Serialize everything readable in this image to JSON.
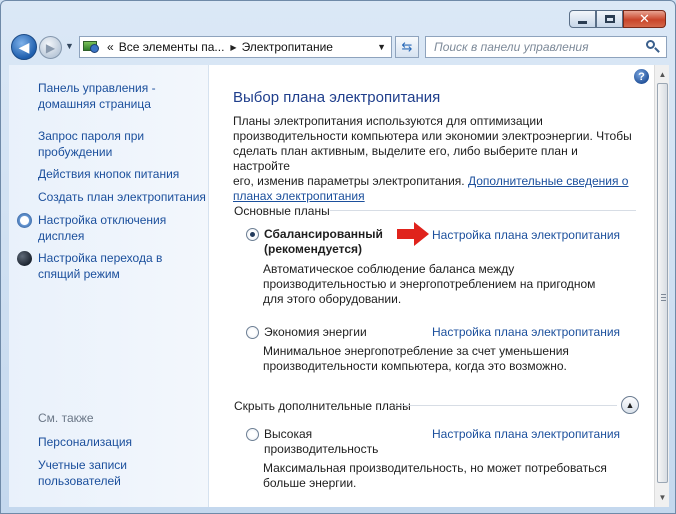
{
  "titlebar": {
    "minimize": "minimize-icon",
    "maximize": "maximize-icon",
    "close": "close-icon"
  },
  "address": {
    "prefix": "«",
    "crumbs": [
      "Все элементы па...",
      "Электропитание"
    ],
    "separator": "▶"
  },
  "search": {
    "placeholder": "Поиск в панели управления"
  },
  "sidebar": {
    "home_line1": "Панель управления -",
    "home_line2": "домашняя страница",
    "items": [
      {
        "l1": "Запрос пароля при",
        "l2": "пробуждении"
      },
      {
        "l1": "Действия кнопок питания"
      },
      {
        "l1": "Создать план электропитания"
      },
      {
        "l1": "Настройка отключения",
        "l2": "дисплея",
        "icon": "display-off-icon"
      },
      {
        "l1": "Настройка перехода в",
        "l2": "спящий режим",
        "icon": "sleep-moon-icon"
      }
    ],
    "see_also": "См. также",
    "see_also_items": [
      {
        "l1": "Персонализация"
      },
      {
        "l1": "Учетные записи",
        "l2": "пользователей"
      }
    ]
  },
  "main": {
    "title": "Выбор плана электропитания",
    "intro_1": "Планы электропитания используются для оптимизации",
    "intro_2": "производительности компьютера или экономии электроэнергии. Чтобы",
    "intro_3": "сделать план активным, выделите его, либо выберите план и настройте",
    "intro_4a": "его, изменив параметры электропитания. ",
    "intro_link_a": "Дополнительные сведения о",
    "intro_link_b": "планах электропитания",
    "basic_plans": "Основные планы",
    "hidden_plans": "Скрыть дополнительные планы",
    "plans": [
      {
        "name1": "Сбалансированный",
        "name2": "(рекомендуется)",
        "selected": true,
        "link": "Настройка плана электропитания",
        "desc1": "Автоматическое соблюдение баланса между",
        "desc2": "производительностью и энергопотреблением на пригодном",
        "desc3": "для этого оборудовании."
      },
      {
        "name1": "Экономия энергии",
        "selected": false,
        "link": "Настройка плана электропитания",
        "desc1": "Минимальное энергопотребление за счет уменьшения",
        "desc2": "производительности компьютера, когда это возможно."
      },
      {
        "name1": "Высокая",
        "name2": "производительность",
        "selected": false,
        "link": "Настройка плана электропитания",
        "desc1": "Максимальная производительность, но может потребоваться",
        "desc2": "больше энергии."
      }
    ]
  },
  "colors": {
    "link": "#1b4f9c",
    "title": "#1f3e8c",
    "arrow": "#e0231c"
  }
}
